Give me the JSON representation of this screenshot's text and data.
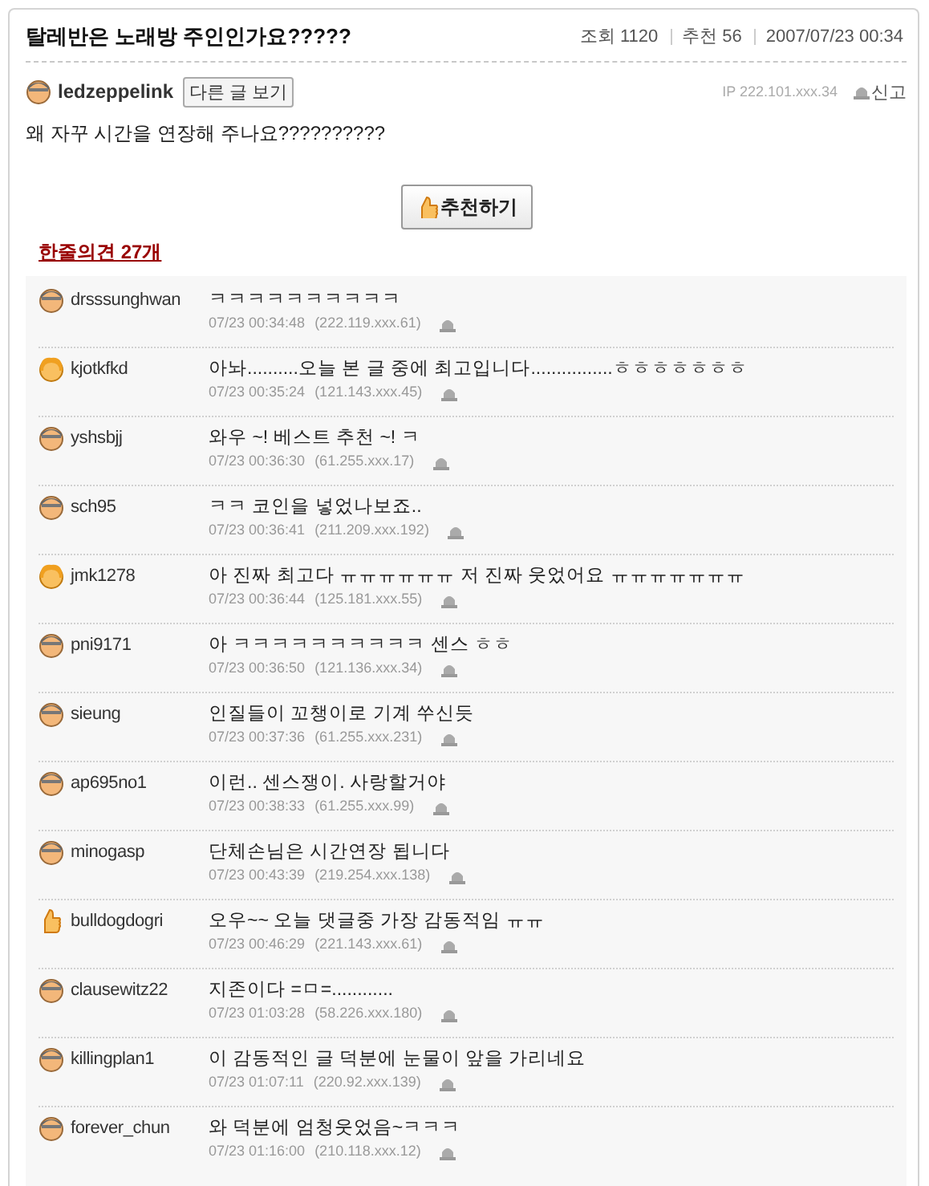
{
  "post": {
    "title": "탈레반은 노래방 주인인가요?????",
    "views_label": "조회",
    "views": "1120",
    "recommend_label": "추천",
    "recommends": "56",
    "date": "2007/07/23 00:34"
  },
  "author": {
    "name": "ledzeppelink",
    "kind": "man",
    "other_posts_button": "다른 글 보기",
    "ip": "IP 222.101.xxx.34",
    "report": "신고"
  },
  "body": "왜 자꾸 시간을 연장해 주나요??????????",
  "recommend_button": "추천하기",
  "comments_heading": "한줄의견 27개",
  "comments": [
    {
      "user": "drsssunghwan",
      "kind": "man",
      "text": "ㅋㅋㅋㅋㅋㅋㅋㅋㅋㅋ",
      "time": "07/23 00:34:48",
      "ip": "(222.119.xxx.61)"
    },
    {
      "user": "kjotkfkd",
      "kind": "girl",
      "text": "아놔..........오늘 본 글 중에 최고입니다................ㅎㅎㅎㅎㅎㅎㅎ",
      "time": "07/23 00:35:24",
      "ip": "(121.143.xxx.45)"
    },
    {
      "user": "yshsbjj",
      "kind": "man",
      "text": "와우 ~! 베스트 추천 ~! ㅋ",
      "time": "07/23 00:36:30",
      "ip": "(61.255.xxx.17)"
    },
    {
      "user": "sch95",
      "kind": "man",
      "text": "ㅋㅋ 코인을 넣었나보죠..",
      "time": "07/23 00:36:41",
      "ip": "(211.209.xxx.192)"
    },
    {
      "user": "jmk1278",
      "kind": "girl",
      "text": "아 진짜 최고다 ㅠㅠㅠㅠㅠㅠ 저 진짜 웃었어요 ㅠㅠㅠㅠㅠㅠㅠ",
      "time": "07/23 00:36:44",
      "ip": "(125.181.xxx.55)"
    },
    {
      "user": "pni9171",
      "kind": "man",
      "text": "아 ㅋㅋㅋㅋㅋㅋㅋㅋㅋㅋ 센스 ㅎㅎ",
      "time": "07/23 00:36:50",
      "ip": "(121.136.xxx.34)"
    },
    {
      "user": "sieung",
      "kind": "man",
      "text": "인질들이 꼬챙이로 기계 쑤신듯",
      "time": "07/23 00:37:36",
      "ip": "(61.255.xxx.231)"
    },
    {
      "user": "ap695no1",
      "kind": "man",
      "text": "이런.. 센스쟁이. 사랑할거야",
      "time": "07/23 00:38:33",
      "ip": "(61.255.xxx.99)"
    },
    {
      "user": "minogasp",
      "kind": "man",
      "text": "단체손님은 시간연장 됩니다",
      "time": "07/23 00:43:39",
      "ip": "(219.254.xxx.138)"
    },
    {
      "user": "bulldogdogri",
      "kind": "thumb",
      "text": "오우~~ 오늘 댓글중 가장 감동적임 ㅠㅠ",
      "time": "07/23 00:46:29",
      "ip": "(221.143.xxx.61)"
    },
    {
      "user": "clausewitz22",
      "kind": "man",
      "text": "지존이다 =ㅁ=............",
      "time": "07/23 01:03:28",
      "ip": "(58.226.xxx.180)"
    },
    {
      "user": "killingplan1",
      "kind": "man",
      "text": "이 감동적인 글 덕분에 눈물이 앞을 가리네요",
      "time": "07/23 01:07:11",
      "ip": "(220.92.xxx.139)"
    },
    {
      "user": "forever_chun",
      "kind": "man",
      "text": "와 덕분에 엄청웃었음~ㅋㅋㅋ",
      "time": "07/23 01:16:00",
      "ip": "(210.118.xxx.12)"
    }
  ]
}
